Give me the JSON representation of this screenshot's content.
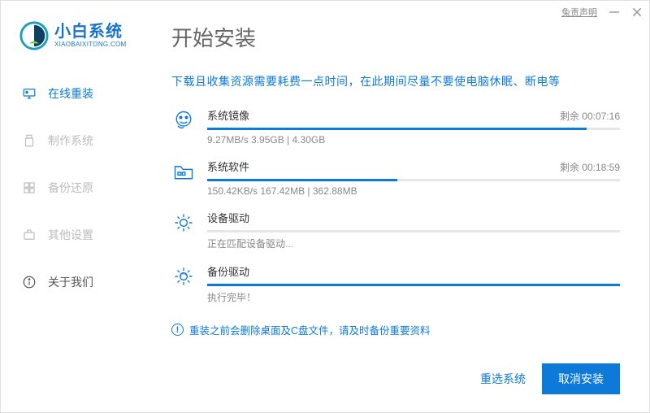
{
  "titlebar": {
    "disclaimer": "兔责声明"
  },
  "logo": {
    "cn": "小白系统",
    "en": "XIAOBAIXITONG.COM"
  },
  "nav": {
    "items": [
      {
        "label": "在线重装"
      },
      {
        "label": "制作系统"
      },
      {
        "label": "备份还原"
      },
      {
        "label": "其他设置"
      },
      {
        "label": "关于我们"
      }
    ]
  },
  "page": {
    "title": "开始安装"
  },
  "notice": "下载且收集资源需要耗费一点时间，在此期间尽量不要使电脑休眠、断电等",
  "tasks": [
    {
      "title": "系统镜像",
      "sub": "9.27MB/s 3.95GB | 4.30GB",
      "remain": "剩余 00:07:16",
      "pct": 92
    },
    {
      "title": "系统软件",
      "sub": "150.42KB/s 167.42MB | 362.88MB",
      "remain": "剩余 00:18:59",
      "pct": 46
    },
    {
      "title": "设备驱动",
      "sub": "正在匹配设备驱动...",
      "remain": "",
      "pct": 0
    },
    {
      "title": "备份驱动",
      "sub": "执行完毕！",
      "remain": "",
      "pct": 100
    }
  ],
  "warn": "重装之前会删除桌面及C盘文件，请及时备份重要资料",
  "footer": {
    "reselect": "重选系统",
    "cancel": "取消安装"
  }
}
